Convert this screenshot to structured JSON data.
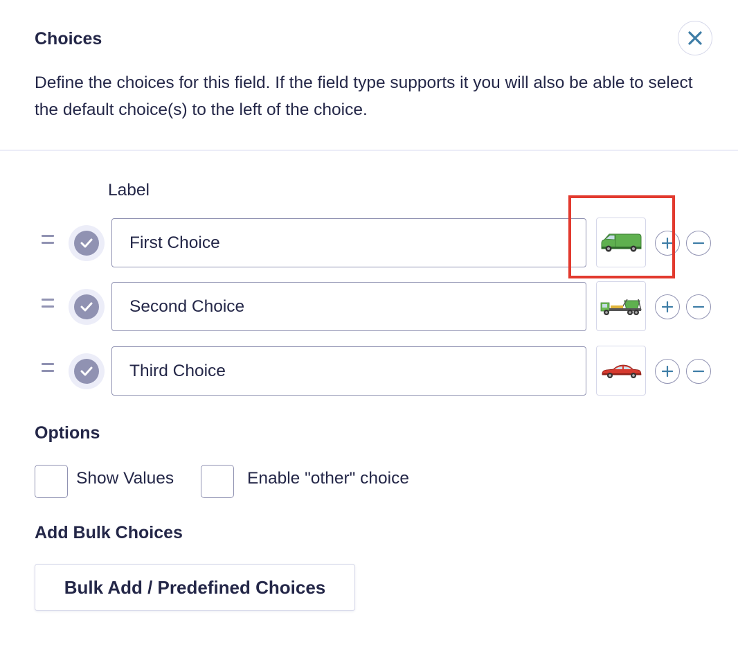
{
  "header": {
    "title": "Choices",
    "close_icon": "close-icon",
    "description": "Define the choices for this field. If the field type supports it you will also be able to select the default choice(s) to the left of the choice."
  },
  "choices": {
    "column_label": "Label",
    "items": [
      {
        "label": "First Choice",
        "default_selected": true,
        "image": "green-van"
      },
      {
        "label": "Second Choice",
        "default_selected": true,
        "image": "skip-loader-truck"
      },
      {
        "label": "Third Choice",
        "default_selected": true,
        "image": "red-sedan"
      }
    ],
    "add_icon": "plus-icon",
    "remove_icon": "minus-icon",
    "highlight_color": "#e23a2e"
  },
  "options": {
    "title": "Options",
    "show_values_label": "Show Values",
    "show_values_checked": false,
    "other_choice_label": "Enable \"other\" choice",
    "other_choice_checked": false
  },
  "bulk": {
    "title": "Add Bulk Choices",
    "button_label": "Bulk Add / Predefined Choices"
  },
  "colors": {
    "text": "#242748",
    "muted": "#9092b2",
    "border_light": "#d5d7e9",
    "close_icon": "#3e7da6"
  }
}
